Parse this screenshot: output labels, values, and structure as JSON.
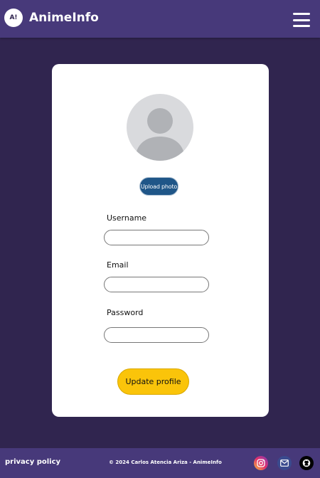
{
  "header": {
    "logo_text": "A!",
    "brand": "AnimeInfo",
    "menu_icon": "hamburger-menu-icon"
  },
  "profile_form": {
    "avatar_icon": "default-user-avatar-icon",
    "upload_label": "Upload photo",
    "username_label": "Username",
    "username_value": "",
    "email_label": "Email",
    "email_value": "",
    "password_label": "Password",
    "password_value": "",
    "submit_label": "Update profile"
  },
  "footer": {
    "privacy_label": "privacy policy",
    "copyright": "© 2024 Carlos Atencia Ariza - AnimeInfo",
    "social": [
      "instagram-icon",
      "mail-icon",
      "github-icon"
    ]
  },
  "colors": {
    "page_bg": "#30254f",
    "bar_bg": "#47397a",
    "upload_button": "#1f5688",
    "submit_button": "#fac40a"
  }
}
